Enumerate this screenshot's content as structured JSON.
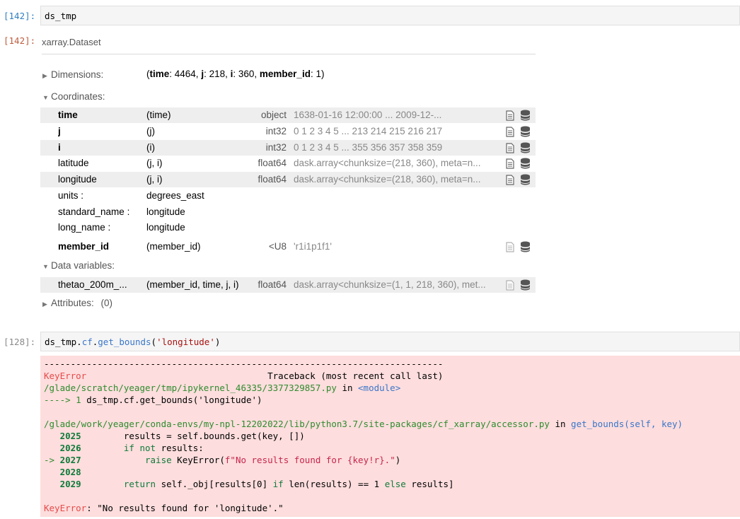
{
  "cell1": {
    "in_prompt": "[142]:",
    "code": "ds_tmp",
    "out_prompt": "[142]:"
  },
  "repr": {
    "header": "xarray.Dataset",
    "dimensions": {
      "label": "Dimensions:",
      "value_parts": [
        {
          "text": "(",
          "bold": false
        },
        {
          "text": "time",
          "bold": true
        },
        {
          "text": ": 4464, ",
          "bold": false
        },
        {
          "text": "j",
          "bold": true
        },
        {
          "text": ": 218, ",
          "bold": false
        },
        {
          "text": "i",
          "bold": true
        },
        {
          "text": ": 360, ",
          "bold": false
        },
        {
          "text": "member_id",
          "bold": true
        },
        {
          "text": ": 1)",
          "bold": false
        }
      ]
    },
    "coordinates_label": "Coordinates:",
    "coordinates": [
      {
        "name": "time",
        "bold": true,
        "dims": "(time)",
        "dtype": "object",
        "preview": "1638-01-16 12:00:00 ... 2009-12-...",
        "shaded": true
      },
      {
        "name": "j",
        "bold": true,
        "dims": "(j)",
        "dtype": "int32",
        "preview": "0 1 2 3 4 5 ... 213 214 215 216 217",
        "shaded": false
      },
      {
        "name": "i",
        "bold": true,
        "dims": "(i)",
        "dtype": "int32",
        "preview": "0 1 2 3 4 5 ... 355 356 357 358 359",
        "shaded": true
      },
      {
        "name": "latitude",
        "bold": false,
        "dims": "(j, i)",
        "dtype": "float64",
        "preview": "dask.array<chunksize=(218, 360), meta=n...",
        "shaded": false
      },
      {
        "name": "longitude",
        "bold": false,
        "dims": "(j, i)",
        "dtype": "float64",
        "preview": "dask.array<chunksize=(218, 360), meta=n...",
        "shaded": true
      }
    ],
    "longitude_attrs": [
      {
        "key": "units :",
        "value": "degrees_east"
      },
      {
        "key": "standard_name :",
        "value": "longitude"
      },
      {
        "key": "long_name :",
        "value": "longitude"
      }
    ],
    "member_id": {
      "name": "member_id",
      "dims": "(member_id)",
      "dtype": "<U8",
      "preview": "'r1i1p1f1'"
    },
    "data_vars_label": "Data variables:",
    "data_vars": [
      {
        "name": "thetao_200m_...",
        "dims": "(member_id, time, j, i)",
        "dtype": "float64",
        "preview": "dask.array<chunksize=(1, 1, 218, 360), met..."
      }
    ],
    "attributes_label": "Attributes:",
    "attributes_count": "(0)"
  },
  "cell2": {
    "in_prompt": "[128]:",
    "code_parts": [
      {
        "text": "ds_tmp",
        "cls": ""
      },
      {
        "text": ".",
        "cls": ""
      },
      {
        "text": "cf",
        "cls": "c-blue"
      },
      {
        "text": ".",
        "cls": ""
      },
      {
        "text": "get_bounds",
        "cls": "c-blue"
      },
      {
        "text": "(",
        "cls": ""
      },
      {
        "text": "'longitude'",
        "cls": "c-str2"
      },
      {
        "text": ")",
        "cls": ""
      }
    ]
  },
  "traceback": {
    "dashes": "---------------------------------------------------------------------------",
    "err_name": "KeyError",
    "tb_header": "                                  Traceback (most recent call last)",
    "file1": "/glade/scratch/yeager/tmp/ipykernel_46335/3377329857.py",
    "in_word": " in ",
    "module": "<module>",
    "arrow_line_prefix": "----> 1 ",
    "arrow_line_code": "ds_tmp.cf.get_bounds('longitude')",
    "file2": "/glade/work/yeager/conda-envs/my-npl-12202022/lib/python3.7/site-packages/cf_xarray/accessor.py",
    "func": "get_bounds(self, key)",
    "code_lines": [
      {
        "prefix": "   ",
        "num": "2025",
        "text": "        results = self.bounds.get(key, [])"
      },
      {
        "prefix": "   ",
        "num": "2026",
        "text": "        if not results:"
      },
      {
        "prefix": "-> ",
        "num": "2027",
        "text": "            raise KeyError(f\"No results found for {key!r}.\")"
      },
      {
        "prefix": "   ",
        "num": "2028",
        "text": ""
      },
      {
        "prefix": "   ",
        "num": "2029",
        "text": "        return self._obj[results[0] if len(results) == 1 else results]"
      }
    ],
    "final_err": "KeyError",
    "final_msg": ": \"No results found for 'longitude'.\""
  },
  "colors": {
    "in_prompt": "#307fc1",
    "out_prompt": "#bf5b3d",
    "error_bg": "#fddddd"
  },
  "icons": [
    "file-icon",
    "database-icon"
  ]
}
